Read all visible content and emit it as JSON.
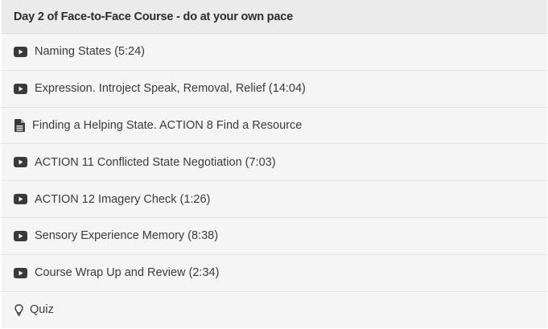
{
  "section": {
    "title": "Day 2 of Face-to-Face Course - do at your own pace",
    "items": [
      {
        "label": "Naming States (5:24)",
        "icon": "video-play-icon"
      },
      {
        "label": "Expression. Introject Speak, Removal, Relief (14:04)",
        "icon": "video-play-icon"
      },
      {
        "label": "Finding a Helping State. ACTION 8 Find a Resource",
        "icon": "document-icon"
      },
      {
        "label": "ACTION 11 Conflicted State Negotiation (7:03)",
        "icon": "video-play-icon"
      },
      {
        "label": "ACTION 12 Imagery Check (1:26)",
        "icon": "video-play-icon"
      },
      {
        "label": "Sensory Experience Memory (8:38)",
        "icon": "video-play-icon"
      },
      {
        "label": "Course Wrap Up and Review (2:34)",
        "icon": "video-play-icon"
      },
      {
        "label": "Quiz",
        "icon": "lightbulb-icon"
      }
    ]
  },
  "colors": {
    "header_bg": "#ebebeb",
    "item_bg": "#f5f5f5",
    "text": "#3b3b3b",
    "icon": "#3a3a3a"
  }
}
